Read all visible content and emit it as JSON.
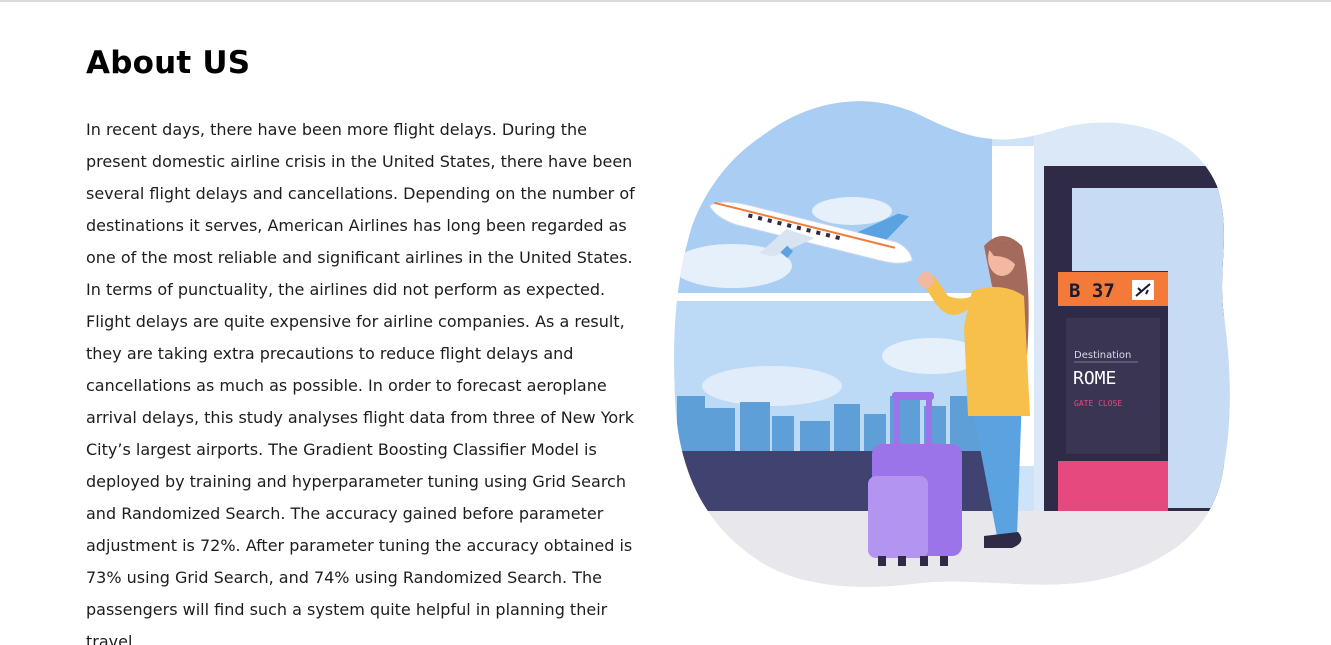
{
  "section": {
    "title": "About US",
    "paragraph": "In recent days, there have been more flight delays. During the present domestic airline crisis in the United States, there have been several flight delays and cancellations. Depending on the number of destinations it serves, American Airlines has long been regarded as one of the most reliable and significant airlines in the United States. In terms of punctuality, the airlines did not perform as expected. Flight delays are quite expensive for airline companies. As a result, they are taking extra precautions to reduce flight delays and cancellations as much as possible. In order to forecast aeroplane arrival delays, this study analyses flight data from three of New York City’s largest airports. The Gradient Boosting Classifier Model is deployed by training and hyperparameter tuning using Grid Search and Randomized Search. The accuracy gained before parameter adjustment is 72%. After parameter tuning the accuracy obtained is 73% using Grid Search, and 74% using Randomized Search. The passengers will find such a system quite helpful in planning their travel."
  },
  "illustration": {
    "gate_label": "B 37",
    "board_heading": "Destination",
    "board_city": "ROME",
    "board_status": "GATE CLOSE",
    "colors": {
      "sky": "#a9cdf3",
      "board_orange": "#f47a3a",
      "board_dark": "#2f2a45",
      "board_pink": "#e5497e",
      "suitcase": "#9a74e8",
      "jacket": "#f7c04a",
      "pants": "#5aa2e0"
    },
    "icons": [
      "airplane-icon"
    ]
  }
}
